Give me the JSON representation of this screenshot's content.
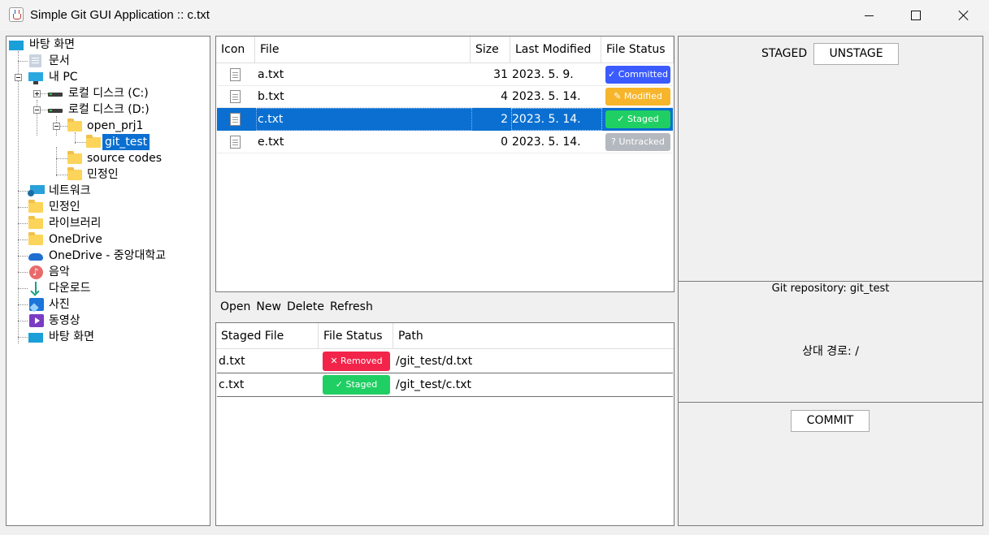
{
  "window": {
    "title": "Simple Git GUI Application :: c.txt"
  },
  "tree": [
    {
      "label": "바탕 화면",
      "icon": "desktop-icon"
    },
    {
      "label": "문서",
      "icon": "document-folder-icon"
    },
    {
      "label": "내 PC",
      "icon": "computer-icon"
    },
    {
      "label": "로컬 디스크 (C:)",
      "icon": "drive-icon"
    },
    {
      "label": "로컬 디스크 (D:)",
      "icon": "drive-icon"
    },
    {
      "label": "open_prj1",
      "icon": "folder-icon"
    },
    {
      "label": "git_test",
      "icon": "folder-icon",
      "selected": true
    },
    {
      "label": "source codes",
      "icon": "folder-icon"
    },
    {
      "label": "민정인",
      "icon": "folder-icon"
    },
    {
      "label": "네트워크",
      "icon": "network-icon"
    },
    {
      "label": "민정인",
      "icon": "folder-icon"
    },
    {
      "label": "라이브러리",
      "icon": "folder-icon"
    },
    {
      "label": "OneDrive",
      "icon": "folder-icon"
    },
    {
      "label": "OneDrive - 중앙대학교",
      "icon": "cloud-icon"
    },
    {
      "label": "음악",
      "icon": "music-icon"
    },
    {
      "label": "다운로드",
      "icon": "download-icon"
    },
    {
      "label": "사진",
      "icon": "pictures-icon"
    },
    {
      "label": "동영상",
      "icon": "videos-icon"
    },
    {
      "label": "바탕 화면",
      "icon": "desktop-icon"
    }
  ],
  "files": {
    "columns": [
      "Icon",
      "File",
      "Size",
      "Last Modified",
      "File Status"
    ],
    "rows": [
      {
        "name": "a.txt",
        "size": "31",
        "modified": "2023. 5. 9.",
        "status": "Committed",
        "status_icon": "✓",
        "color": "#3b5bff"
      },
      {
        "name": "b.txt",
        "size": "4",
        "modified": "2023. 5. 14.",
        "status": "Modified",
        "status_icon": "✎",
        "color": "#f7b52b"
      },
      {
        "name": "c.txt",
        "size": "2",
        "modified": "2023. 5. 14.",
        "status": "Staged",
        "status_icon": "✓",
        "color": "#1fcf63",
        "selected": true
      },
      {
        "name": "e.txt",
        "size": "0",
        "modified": "2023. 5. 14.",
        "status": "Untracked",
        "status_icon": "?",
        "color": "#b4b9bf"
      }
    ]
  },
  "toolbar": {
    "open": "Open",
    "new": "New",
    "delete": "Delete",
    "refresh": "Refresh"
  },
  "staged": {
    "columns": [
      "Staged File",
      "File Status",
      "Path"
    ],
    "rows": [
      {
        "name": "d.txt",
        "status": "Removed",
        "status_icon": "✕",
        "color": "#f2244a",
        "path": "/git_test/d.txt"
      },
      {
        "name": "c.txt",
        "status": "Staged",
        "status_icon": "✓",
        "color": "#1fcf63",
        "path": "/git_test/c.txt"
      }
    ]
  },
  "right": {
    "staged_label": "STAGED",
    "unstage_button": "UNSTAGE",
    "repo_text": "Git repository: git_test",
    "relpath_text": "상대 경로: /",
    "commit_button": "COMMIT"
  }
}
